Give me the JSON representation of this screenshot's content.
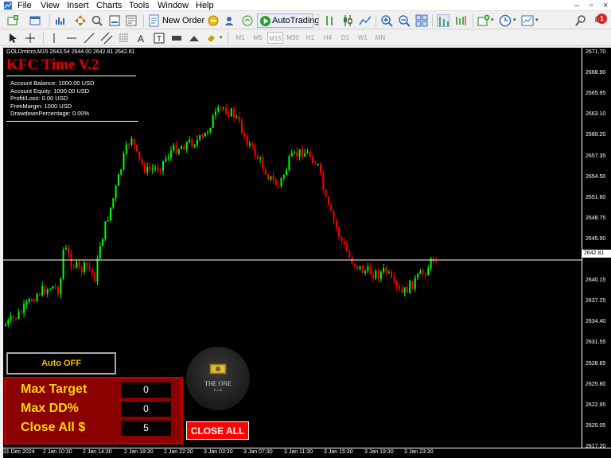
{
  "menu": {
    "items": [
      "File",
      "View",
      "Insert",
      "Charts",
      "Tools",
      "Window",
      "Help"
    ],
    "window_controls": [
      "–",
      "▫",
      "×"
    ]
  },
  "toolbar": {
    "new_order_label": "New Order",
    "autotrading_label": "AutoTrading",
    "notification_count": "1",
    "timeframes": [
      "M1",
      "M5",
      "M15",
      "M30",
      "H1",
      "H4",
      "D1",
      "W1",
      "MN"
    ],
    "active_timeframe": "M15",
    "text_tool": "A",
    "text_label_tool": "T"
  },
  "chart": {
    "symbol_line": "GOLDmicro,M15  2643.54 2644.00 2642.81 2642.81",
    "ea_title": "KFC Time V.2",
    "account_info": [
      "Account Balance: 1000.00 USD",
      "Account Equity: 1000.00 USD",
      "Profit/Loss: 0.00 USD",
      "FreeMargin: 1000 USD",
      "DrawdownPercentage: 0.00%"
    ],
    "current_price": "2642.81",
    "price_ticks": [
      "2671.70",
      "2668.90",
      "2665.95",
      "2663.10",
      "2660.20",
      "2657.35",
      "2654.50",
      "2651.60",
      "2648.75",
      "2645.90",
      "2640.15",
      "2637.25",
      "2634.40",
      "2631.55",
      "2628.65",
      "2625.80",
      "2622.95",
      "2620.05",
      "2617.20"
    ],
    "time_ticks": [
      "31 Dec 2024",
      "2 Jan 10:30",
      "2 Jan 14:30",
      "2 Jan 18:30",
      "2 Jan 22:30",
      "3 Jan 03:30",
      "3 Jan 07:30",
      "3 Jan 11:30",
      "3 Jan 15:30",
      "3 Jan 19:30",
      "3 Jan 23:30"
    ],
    "colors": {
      "bull": "#00ff00",
      "bear": "#ff0000",
      "background": "#000000",
      "foreground": "#ffffff"
    }
  },
  "panel": {
    "auto_button": "Auto OFF",
    "max_target_label": "Max Target",
    "max_target_value": "0",
    "max_dd_label": "Max DD%",
    "max_dd_value": "0",
    "close_all_label": "Close All $",
    "close_all_value": "5",
    "close_all_button": "CLOSE ALL"
  },
  "logo": {
    "title": "THE ONE",
    "subtitle": "PLUS"
  }
}
